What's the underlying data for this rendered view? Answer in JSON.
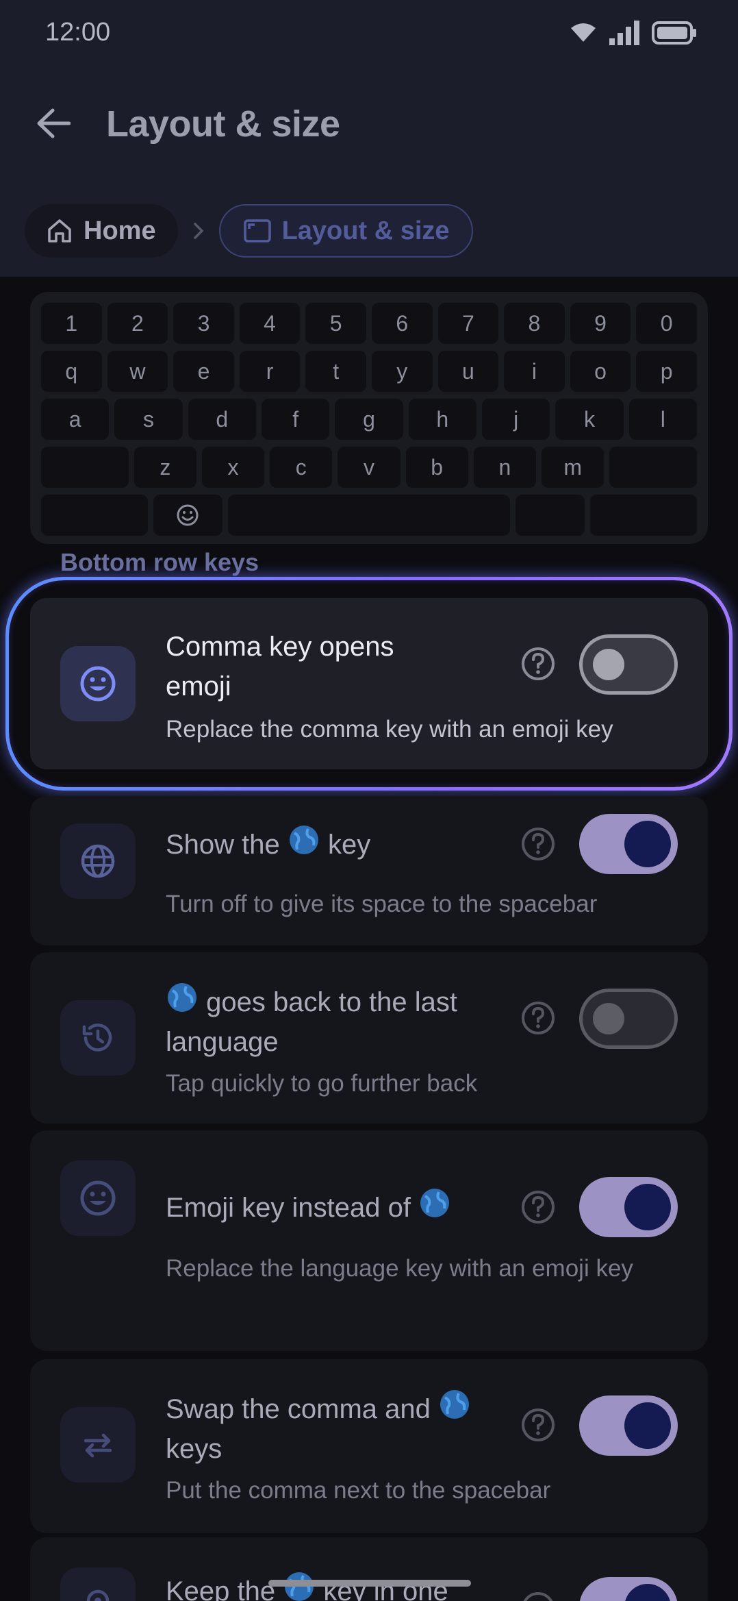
{
  "status": {
    "time": "12:00"
  },
  "appbar": {
    "title": "Layout & size"
  },
  "breadcrumb": {
    "home": "Home",
    "current": "Layout & size"
  },
  "keyboard": {
    "rows": [
      [
        "1",
        "2",
        "3",
        "4",
        "5",
        "6",
        "7",
        "8",
        "9",
        "0"
      ],
      [
        "q",
        "w",
        "e",
        "r",
        "t",
        "y",
        "u",
        "i",
        "o",
        "p"
      ],
      [
        "a",
        "s",
        "d",
        "f",
        "g",
        "h",
        "j",
        "k",
        "l"
      ],
      [
        "z",
        "x",
        "c",
        "v",
        "b",
        "n",
        "m"
      ]
    ]
  },
  "section": {
    "label": "Bottom row keys"
  },
  "settings": [
    {
      "title": "Comma key opens emoji",
      "subtitle": "Replace the comma key with an emoji key",
      "icon": "smiley-icon",
      "enabled": false
    },
    {
      "title_pre": "Show the",
      "title_post": "key",
      "subtitle": "Turn off to give its space to the spacebar",
      "icon": "globe-icon",
      "enabled": true
    },
    {
      "title_post": "goes back to the last language",
      "subtitle": "Tap quickly to go further back",
      "icon": "history-icon",
      "enabled": false
    },
    {
      "title_pre": "Emoji key instead of",
      "subtitle": "Replace the language key with an emoji key",
      "icon": "smiley-icon",
      "enabled": true
    },
    {
      "title_pre": "Swap the comma and",
      "title_post": "keys",
      "subtitle": "Put the comma next to the spacebar",
      "icon": "swap-icon",
      "enabled": true
    },
    {
      "title_pre": "Keep the",
      "title_post": "key in one",
      "subtitle": "",
      "icon": "pin-icon",
      "enabled": true
    }
  ],
  "colors": {
    "accent": "#6e78ff",
    "toggle_on": "#9d92c4",
    "knob_on": "#141a52"
  }
}
